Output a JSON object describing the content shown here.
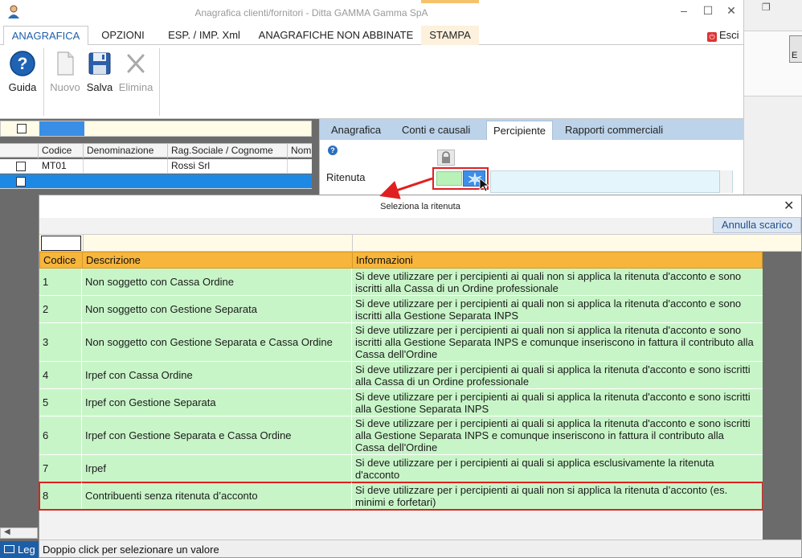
{
  "window": {
    "title": "Anagrafica clienti/fornitori - Ditta GAMMA Gamma SpA",
    "minimize": "–",
    "maximize": "☐",
    "close": "✕"
  },
  "ribbon_tabs": [
    "ANAGRAFICA",
    "OPZIONI",
    "ESP. / IMP. Xml",
    "ANAGRAFICHE NON ABBINATE",
    "STAMPA"
  ],
  "esci_label": "Esci",
  "ribbon_buttons": {
    "guida": "Guida",
    "nuovo": "Nuovo",
    "salva": "Salva",
    "elimina": "Elimina"
  },
  "bg_right": {
    "btn_letter": "E"
  },
  "left_grid": {
    "columns": [
      "Codice",
      "Denominazione",
      "Rag.Sociale / Cognome",
      "Nom"
    ],
    "rows": [
      {
        "codice": "MT01",
        "denominazione": "",
        "rag_sociale": "Rossi Srl",
        "nome": ""
      }
    ]
  },
  "form_tabs": [
    "Anagrafica",
    "Conti e causali",
    "Percipiente",
    "Rapporti commerciali"
  ],
  "form": {
    "ritenuta_label": "Ritenuta"
  },
  "popup": {
    "title": "Seleziona la ritenuta",
    "annulla": "Annulla scarico",
    "columns": [
      "Codice",
      "Descrizione",
      "Informazioni"
    ],
    "rows": [
      {
        "codice": "1",
        "descrizione": "Non soggetto con Cassa Ordine",
        "info": "Si deve utilizzare per i percipienti ai quali non si applica la ritenuta d'acconto e sono iscritti alla Cassa di un Ordine professionale"
      },
      {
        "codice": "2",
        "descrizione": "Non soggetto con Gestione Separata",
        "info": "Si deve utilizzare per i percipienti ai quali non si applica la ritenuta d'acconto e sono iscritti alla Gestione Separata INPS"
      },
      {
        "codice": "3",
        "descrizione": "Non soggetto con Gestione Separata e Cassa Ordine",
        "info": "Si deve utilizzare per i percipienti ai quali non si applica la ritenuta d'acconto e sono iscritti alla Gestione Separata INPS e comunque inseriscono in fattura il contributo alla Cassa dell'Ordine"
      },
      {
        "codice": "4",
        "descrizione": "Irpef con Cassa Ordine",
        "info": "Si deve utilizzare per i percipienti ai quali si applica la ritenuta d'acconto e sono iscritti alla Cassa di un Ordine professionale"
      },
      {
        "codice": "5",
        "descrizione": "Irpef con Gestione Separata",
        "info": "Si deve utilizzare per i percipienti ai quali si applica la ritenuta d'acconto e sono iscritti alla Gestione Separata INPS"
      },
      {
        "codice": "6",
        "descrizione": "Irpef con Gestione Separata e Cassa Ordine",
        "info": "Si deve utilizzare per i percipienti ai quali si applica la ritenuta d'acconto e sono iscritti alla Gestione Separata INPS e comunque inseriscono in fattura il contributo alla Cassa dell'Ordine"
      },
      {
        "codice": "7",
        "descrizione": "Irpef",
        "info": "Si deve utilizzare per i percipienti ai quali si applica esclusivamente la ritenuta d'acconto"
      },
      {
        "codice": "8",
        "descrizione": "Contribuenti senza ritenuta d’acconto",
        "info": "Si deve utilizzare per i percipienti ai quali non si applica la ritenuta d’acconto (es. minimi e forfetari)"
      }
    ],
    "status": "Doppio click per selezionare un valore"
  },
  "legend_label": "Leg",
  "colors": {
    "header_orange": "#f7b53b",
    "row_green": "#c8f5c8",
    "highlight_red": "#e02020",
    "accent_blue": "#1e88e5"
  }
}
